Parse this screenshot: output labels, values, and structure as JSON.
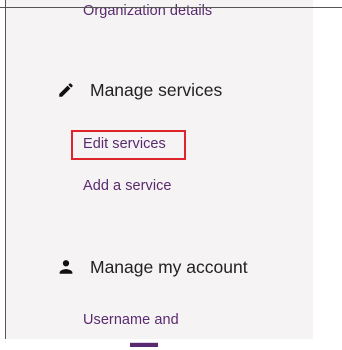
{
  "sidebar": {
    "org_details_link": "Organization details",
    "manage_services": {
      "title": "Manage services",
      "icon": "pencil-icon",
      "links": [
        "Edit services",
        "Add a service"
      ]
    },
    "manage_account": {
      "title": "Manage my account",
      "icon": "person-icon",
      "links": [
        "Username and"
      ]
    }
  },
  "colors": {
    "link": "#5a2a6e",
    "highlight": "#e0242c",
    "sidebar_bg": "#f5f3f4"
  }
}
